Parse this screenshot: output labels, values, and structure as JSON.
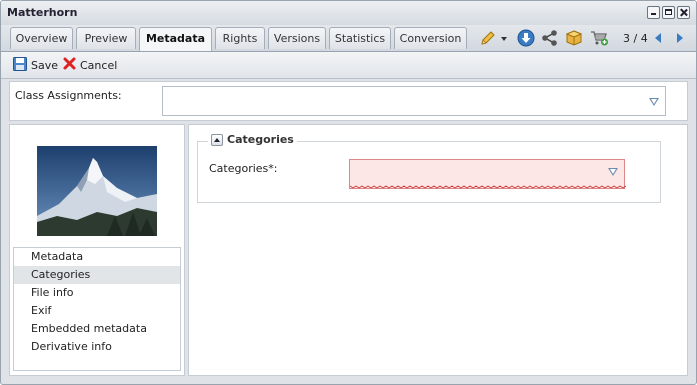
{
  "window": {
    "title": "Matterhorn"
  },
  "tabs": [
    {
      "label": "Overview"
    },
    {
      "label": "Preview"
    },
    {
      "label": "Metadata",
      "active": true
    },
    {
      "label": "Rights"
    },
    {
      "label": "Versions"
    },
    {
      "label": "Statistics"
    },
    {
      "label": "Conversion"
    }
  ],
  "tab_icons": [
    "pencil-icon",
    "dropdown-arrow-icon",
    "download-icon",
    "share-icon",
    "package-icon",
    "cart-add-icon"
  ],
  "pager": {
    "text": "3 / 4"
  },
  "toolbar": {
    "save_label": "Save",
    "cancel_label": "Cancel"
  },
  "class_assignments": {
    "label": "Class Assignments:",
    "value": ""
  },
  "nav": {
    "items": [
      {
        "label": "Metadata"
      },
      {
        "label": "Categories",
        "selected": true
      },
      {
        "label": "File info"
      },
      {
        "label": "Exif"
      },
      {
        "label": "Embedded metadata"
      },
      {
        "label": "Derivative info"
      }
    ]
  },
  "categories": {
    "legend": "Categories",
    "field_label": "Categories*:",
    "value": "",
    "invalid": true
  },
  "colors": {
    "accent": "#3a7cc4",
    "invalid_bg": "#fde6e6",
    "selected_bg": "#e2e5e8"
  }
}
